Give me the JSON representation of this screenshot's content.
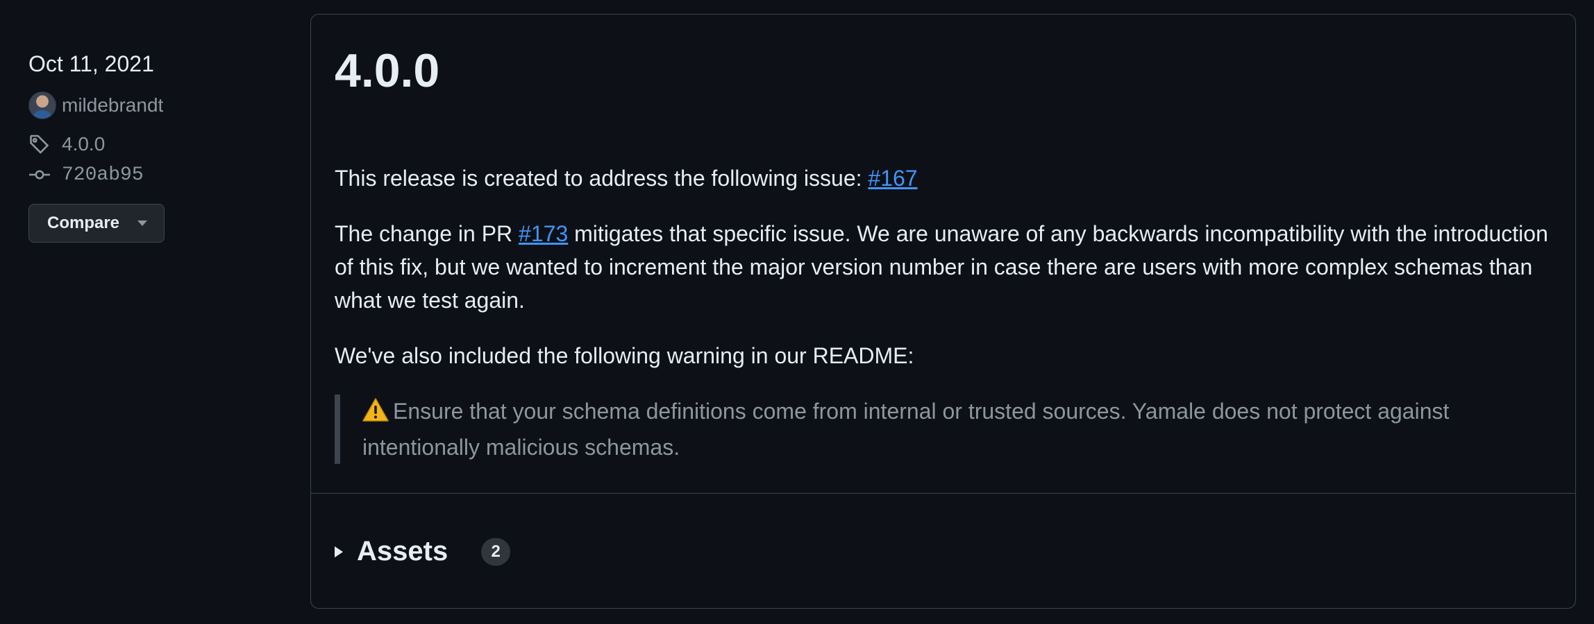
{
  "meta": {
    "date": "Oct 11, 2021",
    "author": "mildebrandt",
    "tag": "4.0.0",
    "commit": "720ab95",
    "compare_label": "Compare"
  },
  "release": {
    "title": "4.0.0",
    "para1_text": "This release is created to address the following issue: ",
    "para1_link": "#167",
    "para2_prefix": "The change in PR ",
    "para2_link": "#173",
    "para2_suffix": " mitigates that specific issue. We are unaware of any backwards incompatibility with the introduction of this fix, but we wanted to increment the major version number in case there are users with more complex schemas than what we test again.",
    "para3_text": "We've also included the following warning in our README:",
    "quote_text": "Ensure that your schema definitions come from internal or trusted sources. Yamale does not protect against intentionally malicious schemas."
  },
  "assets": {
    "label": "Assets",
    "count": "2"
  },
  "colors": {
    "background": "#0d1117",
    "link": "#4493f8",
    "muted": "#8d96a0",
    "border": "#3d444d",
    "warning": "#d29922"
  }
}
